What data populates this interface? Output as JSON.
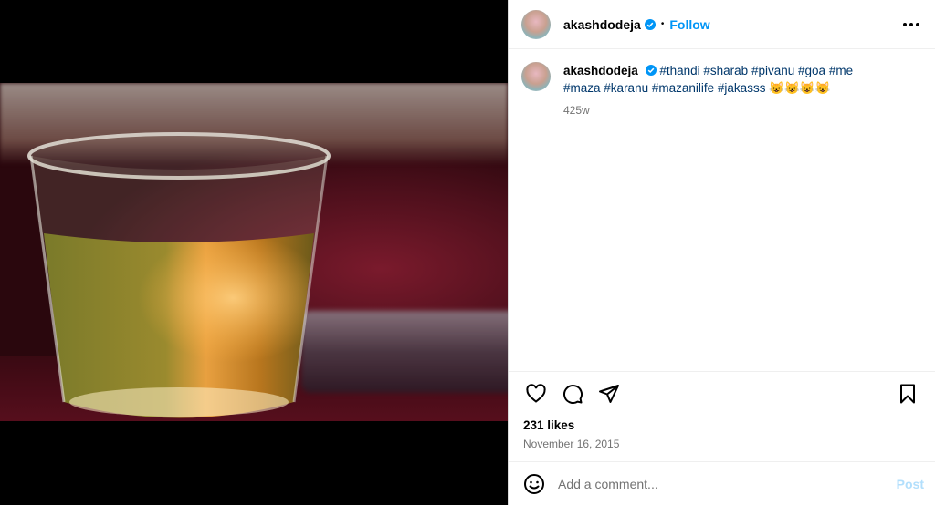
{
  "author": {
    "username": "akashdodeja",
    "follow_label": "Follow",
    "separator": "•"
  },
  "caption": {
    "username": "akashdodeja",
    "hashtags": [
      "#thandi",
      "#sharab",
      "#pivanu",
      "#goa",
      "#me",
      "#maza",
      "#karanu",
      "#mazanilife",
      "#jakasss"
    ],
    "emoji": "😺😺😺😺",
    "age": "425w"
  },
  "engagement": {
    "likes": "231 likes",
    "date": "November 16, 2015"
  },
  "comment_box": {
    "placeholder": "Add a comment...",
    "post_label": "Post"
  },
  "colors": {
    "accent": "#0095f6",
    "hashtag": "#00376b",
    "muted": "#737373"
  }
}
